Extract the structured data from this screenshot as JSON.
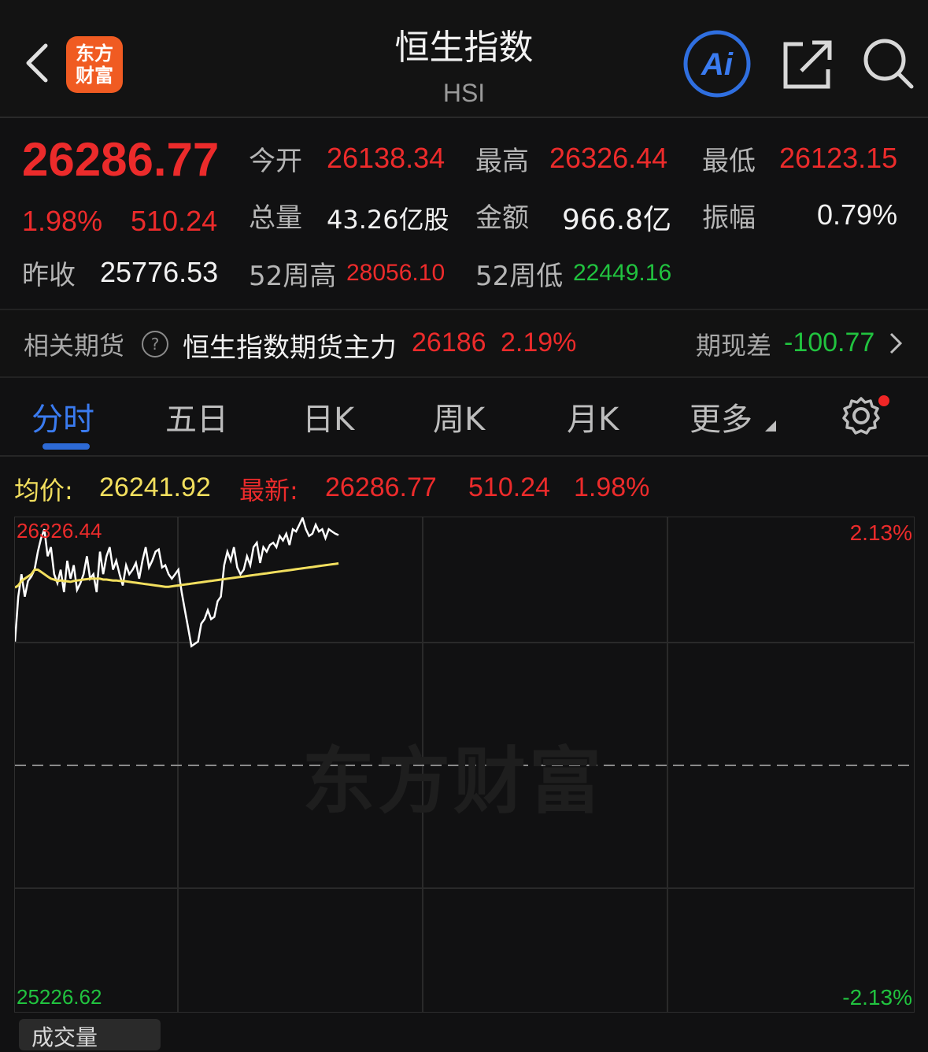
{
  "header": {
    "title": "恒生指数",
    "subtitle": "HSI",
    "logo_line1": "东方",
    "logo_line2": "财富",
    "ai_label": "Ai"
  },
  "quote": {
    "price": "26286.77",
    "change_pct": "1.98%",
    "change": "510.24",
    "open_label": "今开",
    "open": "26138.34",
    "high_label": "最高",
    "high": "26326.44",
    "low_label": "最低",
    "low": "26123.15",
    "volume_label": "总量",
    "volume": "43.26亿股",
    "amount_label": "金额",
    "amount": "966.8亿",
    "amplitude_label": "振幅",
    "amplitude": "0.79%",
    "prev_close_label": "昨收",
    "prev_close": "25776.53",
    "w52_high_label": "52周高",
    "w52_high": "28056.10",
    "w52_low_label": "52周低",
    "w52_low": "22449.16"
  },
  "futures": {
    "label": "相关期货",
    "help_icon": "?",
    "name": "恒生指数期货主力",
    "price": "26186",
    "pct": "2.19%",
    "basis_label": "期现差",
    "basis": "-100.77"
  },
  "tabs": [
    "分时",
    "五日",
    "日K",
    "周K",
    "月K",
    "更多"
  ],
  "chart_header": {
    "avg_label": "均价:",
    "avg_value": "26241.92",
    "latest_label": "最新:",
    "latest_value": "26286.77",
    "latest_change": "510.24",
    "latest_pct": "1.98%"
  },
  "chart_data": {
    "type": "line",
    "y_top_label": "26326.44",
    "y_bottom_label": "25226.62",
    "pct_top_label": "2.13%",
    "pct_bottom_label": "-2.13%",
    "ylim": [
      25226.62,
      26326.44
    ],
    "watermark": "东方财富",
    "x": [
      0,
      2,
      4,
      6,
      8,
      10,
      12,
      14,
      16,
      18,
      20,
      22,
      24,
      26,
      28,
      30,
      32,
      34,
      36,
      38,
      40,
      42,
      44,
      46,
      48,
      50,
      52,
      54,
      56,
      58,
      60,
      62,
      64,
      66,
      68,
      70,
      72,
      74,
      76,
      78,
      80,
      82,
      84,
      86,
      88,
      90,
      92,
      94,
      96,
      98,
      100,
      102,
      104,
      106,
      108,
      110,
      112,
      114,
      116,
      118,
      120,
      122,
      124,
      126,
      128,
      130,
      132,
      134,
      136,
      138,
      140,
      142,
      144,
      146,
      148,
      150,
      152,
      154,
      156,
      158,
      160,
      162,
      164,
      166,
      168,
      170,
      172,
      174,
      176,
      178,
      180,
      182,
      184,
      186,
      188,
      190,
      192,
      194,
      196,
      198
    ],
    "series": [
      {
        "values": [
          26050,
          26150,
          26200,
          26150,
          26185,
          26195,
          26210,
          26250,
          26280,
          26300,
          26240,
          26260,
          26200,
          26180,
          26210,
          26160,
          26230,
          26190,
          26220,
          26165,
          26180,
          26200,
          26240,
          26190,
          26200,
          26160,
          26250,
          26200,
          26240,
          26260,
          26210,
          26230,
          26200,
          26175,
          26220,
          26200,
          26210,
          26225,
          26190,
          26230,
          26260,
          26215,
          26230,
          26250,
          26255,
          26215,
          26220,
          26200,
          26190,
          26200,
          26210,
          26160,
          26120,
          26080,
          26040,
          26045,
          26050,
          26090,
          26100,
          26120,
          26100,
          26105,
          26140,
          26150,
          26220,
          26250,
          26230,
          26260,
          26215,
          26200,
          26210,
          26240,
          26220,
          26260,
          26270,
          26225,
          26260,
          26250,
          26265,
          26270,
          26260,
          26285,
          26275,
          26290,
          26265,
          26300,
          26295,
          26310,
          26325,
          26300,
          26285,
          26290,
          26310,
          26295,
          26300,
          26280,
          26300,
          26295,
          26290,
          26287
        ]
      },
      {
        "values": [
          26170,
          26175,
          26185,
          26190,
          26195,
          26200,
          26210,
          26210,
          26205,
          26200,
          26195,
          26190,
          26188,
          26185,
          26186,
          26185,
          26184,
          26183,
          26185,
          26186,
          26187,
          26188,
          26189,
          26190,
          26190,
          26190,
          26190,
          26188,
          26188,
          26187,
          26186,
          26186,
          26185,
          26185,
          26184,
          26183,
          26182,
          26181,
          26180,
          26179,
          26178,
          26177,
          26176,
          26175,
          26174,
          26173,
          26172,
          26172,
          26173,
          26174,
          26175,
          26176,
          26177,
          26178,
          26179,
          26180,
          26181,
          26182,
          26183,
          26184,
          26185,
          26186,
          26187,
          26188,
          26189,
          26190,
          26191,
          26192,
          26193,
          26194,
          26195,
          26196,
          26197,
          26198,
          26199,
          26200,
          26201,
          26202,
          26203,
          26204,
          26205,
          26206,
          26207,
          26208,
          26209,
          26210,
          26211,
          26212,
          26213,
          26214,
          26215,
          26216,
          26217,
          26218,
          26219,
          26220,
          26221,
          26222,
          26223,
          26224
        ]
      }
    ],
    "colors": {
      "price": "#ffffff",
      "avg": "#f2df5e",
      "prev_close_line": "#8a8a8a"
    }
  },
  "volume_tab": {
    "label": "成交量"
  },
  "colors": {
    "up": "#ec2b2b",
    "down": "#21c33f",
    "accent": "#2d6ad6",
    "background": "#111112"
  }
}
